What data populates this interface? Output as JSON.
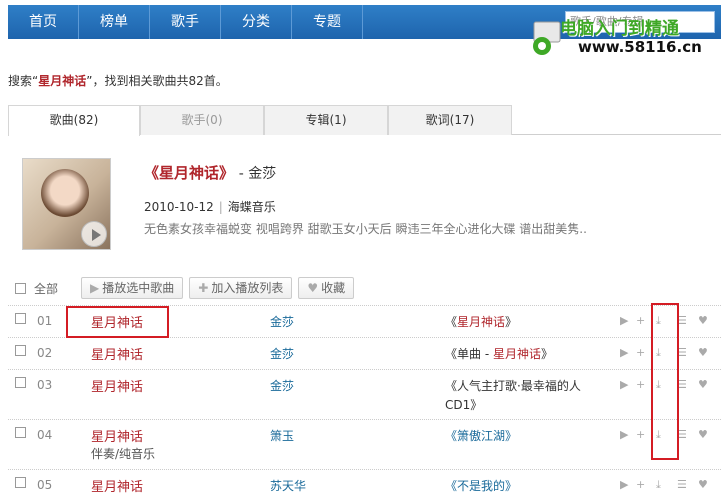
{
  "nav": {
    "items": [
      "首页",
      "榜单",
      "歌手",
      "分类",
      "专题"
    ],
    "search_placeholder": "歌手/歌曲/专辑"
  },
  "watermark": {
    "title": "电脑入门到精通",
    "url": "www.58116.cn"
  },
  "search_result": {
    "prefix": "搜索“",
    "keyword": "星月神话",
    "suffix": "”，找到相关歌曲共82首。"
  },
  "tabs": [
    {
      "label": "歌曲(82)"
    },
    {
      "label": "歌手(0)"
    },
    {
      "label": "专辑(1)"
    },
    {
      "label": "歌词(17)"
    }
  ],
  "album": {
    "title": "《星月神话》",
    "artist": "- 金莎",
    "date": "2010-10-12",
    "label": "海蝶音乐",
    "description": "无色素女孩幸福蜕变 视唱跨界 甜歌玉女小天后 瞬违三年全心进化大碟 谱出甜美隽.."
  },
  "toolbar": {
    "select_all": "全部",
    "play_selected": "播放选中歌曲",
    "add_to_playlist": "加入播放列表",
    "favorite": "收藏"
  },
  "songs": [
    {
      "num": "01",
      "title": "星月神话",
      "subtitle": "",
      "artist": "金莎",
      "album_parts": [
        "《",
        "星月神话",
        "》"
      ],
      "album_mode": "hl"
    },
    {
      "num": "02",
      "title": "星月神话",
      "subtitle": "",
      "artist": "金莎",
      "album_parts": [
        "《单曲 - ",
        "星月神话",
        "》"
      ],
      "album_mode": "hl"
    },
    {
      "num": "03",
      "title": "星月神话",
      "subtitle": "",
      "artist": "金莎",
      "album_parts": [
        "《人气主打歌·最幸福的人 CD1》",
        "",
        ""
      ],
      "album_mode": "plain"
    },
    {
      "num": "04",
      "title": "星月神话",
      "subtitle": "伴奏/纯音乐",
      "artist": "箫玉",
      "album_parts": [
        "《箫傲江湖》",
        "",
        ""
      ],
      "album_mode": "blue"
    },
    {
      "num": "05",
      "title": "星月神话",
      "subtitle": "",
      "artist": "苏天华",
      "album_parts": [
        "《不是我的》",
        "",
        ""
      ],
      "album_mode": "blue"
    }
  ],
  "icons": {
    "play": "play-icon",
    "add": "plus-icon",
    "download": "download-icon",
    "queue": "queue-icon",
    "like": "heart-icon"
  },
  "colors": {
    "nav_bg": "#1e64ad",
    "highlight": "#b0262c",
    "annotation_box": "#d41c24"
  }
}
